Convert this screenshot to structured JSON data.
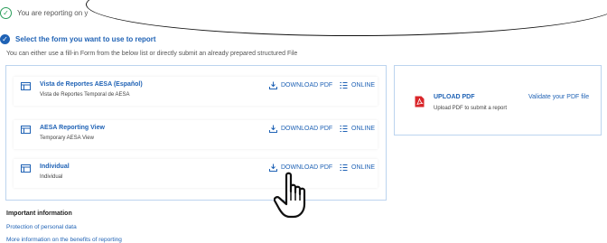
{
  "steps": {
    "step1_text": "You are reporting on y",
    "step2_text": "Select the form you want to use to report",
    "helper_text": "You can either use a fill-in Form from the below list or directly submit an already prepared structured File"
  },
  "forms": [
    {
      "title": "Vista de Reportes AESA (Español)",
      "subtitle": "Vista de Reportes Temporal de AESA",
      "pdf_label": "DOWNLOAD PDF",
      "online_label": "ONLINE"
    },
    {
      "title": "AESA Reporting View",
      "subtitle": "Temporary AESA View",
      "pdf_label": "DOWNLOAD PDF",
      "online_label": "ONLINE"
    },
    {
      "title": "Individual",
      "subtitle": "Individual",
      "pdf_label": "DOWNLOAD PDF",
      "online_label": "ONLINE"
    }
  ],
  "upload": {
    "title": "UPLOAD PDF",
    "subtitle": "Upload PDF to submit a report",
    "validate_label": "Validate your PDF file"
  },
  "info": {
    "heading": "Important information",
    "link1": "Protection of personal data",
    "link2": "More information on the benefits of reporting"
  },
  "colors": {
    "accent": "#1f62b5",
    "success": "#2a9d5a",
    "panel_border": "#bcd4ef",
    "pdf_red": "#d9262a"
  },
  "icons": [
    "check-circle-icon",
    "check-circle-filled-icon",
    "form-icon",
    "download-icon",
    "online-list-icon",
    "pdf-file-icon",
    "hand-pointer-cursor-icon"
  ]
}
